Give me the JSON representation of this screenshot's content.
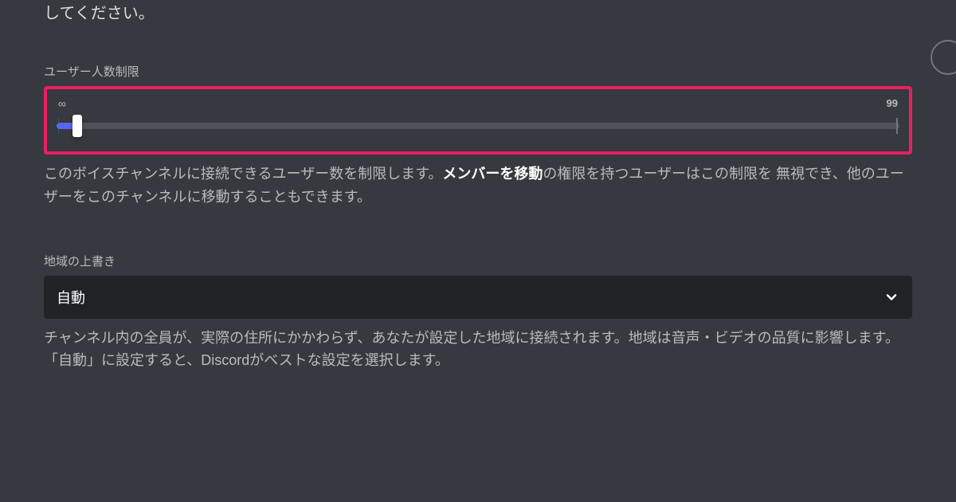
{
  "header": {
    "truncated_text": "してください。"
  },
  "user_limit": {
    "label": "ユーザー人数制限",
    "min_label": "∞",
    "max_label": "99",
    "description_part1": "このボイスチャンネルに接続できるユーザー数を制限します。",
    "description_bold": "メンバーを移動",
    "description_part2": "の権限を持つユーザーはこの制限を 無視でき、他のユーザーをこのチャンネルに移動することもできます。"
  },
  "region": {
    "label": "地域の上書き",
    "selected_value": "自動",
    "description": "チャンネル内の全員が、実際の住所にかかわらず、あなたが設定した地域に接続されます。地域は音声・ビデオの品質に影響します。「自動」に設定すると、Discordがベストな設定を選択します。"
  },
  "colors": {
    "accent": "#5865f2",
    "highlight": "#e91e63",
    "background": "#36393f",
    "dropdown_bg": "#202225"
  }
}
